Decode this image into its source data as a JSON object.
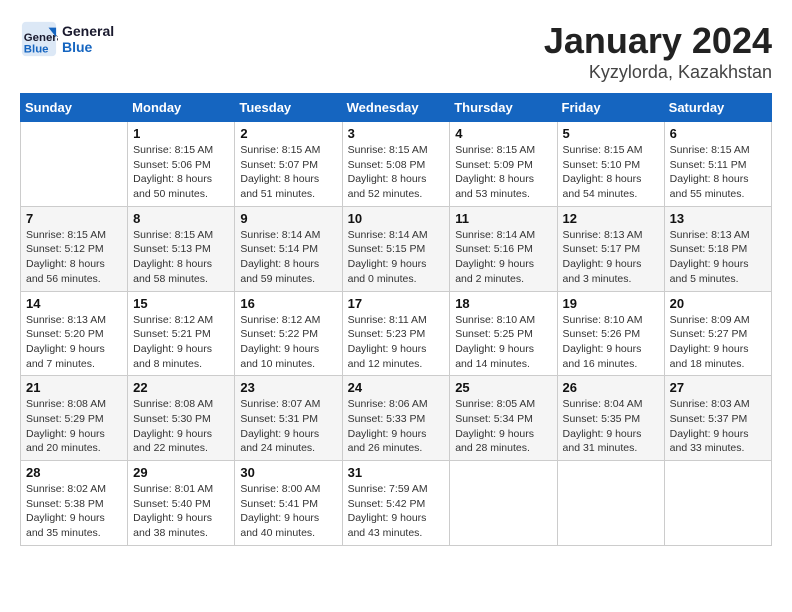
{
  "header": {
    "logo_line1": "General",
    "logo_line2": "Blue",
    "month": "January 2024",
    "location": "Kyzylorda, Kazakhstan"
  },
  "weekdays": [
    "Sunday",
    "Monday",
    "Tuesday",
    "Wednesday",
    "Thursday",
    "Friday",
    "Saturday"
  ],
  "weeks": [
    [
      {
        "day": "",
        "info": ""
      },
      {
        "day": "1",
        "info": "Sunrise: 8:15 AM\nSunset: 5:06 PM\nDaylight: 8 hours\nand 50 minutes."
      },
      {
        "day": "2",
        "info": "Sunrise: 8:15 AM\nSunset: 5:07 PM\nDaylight: 8 hours\nand 51 minutes."
      },
      {
        "day": "3",
        "info": "Sunrise: 8:15 AM\nSunset: 5:08 PM\nDaylight: 8 hours\nand 52 minutes."
      },
      {
        "day": "4",
        "info": "Sunrise: 8:15 AM\nSunset: 5:09 PM\nDaylight: 8 hours\nand 53 minutes."
      },
      {
        "day": "5",
        "info": "Sunrise: 8:15 AM\nSunset: 5:10 PM\nDaylight: 8 hours\nand 54 minutes."
      },
      {
        "day": "6",
        "info": "Sunrise: 8:15 AM\nSunset: 5:11 PM\nDaylight: 8 hours\nand 55 minutes."
      }
    ],
    [
      {
        "day": "7",
        "info": "Sunrise: 8:15 AM\nSunset: 5:12 PM\nDaylight: 8 hours\nand 56 minutes."
      },
      {
        "day": "8",
        "info": "Sunrise: 8:15 AM\nSunset: 5:13 PM\nDaylight: 8 hours\nand 58 minutes."
      },
      {
        "day": "9",
        "info": "Sunrise: 8:14 AM\nSunset: 5:14 PM\nDaylight: 8 hours\nand 59 minutes."
      },
      {
        "day": "10",
        "info": "Sunrise: 8:14 AM\nSunset: 5:15 PM\nDaylight: 9 hours\nand 0 minutes."
      },
      {
        "day": "11",
        "info": "Sunrise: 8:14 AM\nSunset: 5:16 PM\nDaylight: 9 hours\nand 2 minutes."
      },
      {
        "day": "12",
        "info": "Sunrise: 8:13 AM\nSunset: 5:17 PM\nDaylight: 9 hours\nand 3 minutes."
      },
      {
        "day": "13",
        "info": "Sunrise: 8:13 AM\nSunset: 5:18 PM\nDaylight: 9 hours\nand 5 minutes."
      }
    ],
    [
      {
        "day": "14",
        "info": "Sunrise: 8:13 AM\nSunset: 5:20 PM\nDaylight: 9 hours\nand 7 minutes."
      },
      {
        "day": "15",
        "info": "Sunrise: 8:12 AM\nSunset: 5:21 PM\nDaylight: 9 hours\nand 8 minutes."
      },
      {
        "day": "16",
        "info": "Sunrise: 8:12 AM\nSunset: 5:22 PM\nDaylight: 9 hours\nand 10 minutes."
      },
      {
        "day": "17",
        "info": "Sunrise: 8:11 AM\nSunset: 5:23 PM\nDaylight: 9 hours\nand 12 minutes."
      },
      {
        "day": "18",
        "info": "Sunrise: 8:10 AM\nSunset: 5:25 PM\nDaylight: 9 hours\nand 14 minutes."
      },
      {
        "day": "19",
        "info": "Sunrise: 8:10 AM\nSunset: 5:26 PM\nDaylight: 9 hours\nand 16 minutes."
      },
      {
        "day": "20",
        "info": "Sunrise: 8:09 AM\nSunset: 5:27 PM\nDaylight: 9 hours\nand 18 minutes."
      }
    ],
    [
      {
        "day": "21",
        "info": "Sunrise: 8:08 AM\nSunset: 5:29 PM\nDaylight: 9 hours\nand 20 minutes."
      },
      {
        "day": "22",
        "info": "Sunrise: 8:08 AM\nSunset: 5:30 PM\nDaylight: 9 hours\nand 22 minutes."
      },
      {
        "day": "23",
        "info": "Sunrise: 8:07 AM\nSunset: 5:31 PM\nDaylight: 9 hours\nand 24 minutes."
      },
      {
        "day": "24",
        "info": "Sunrise: 8:06 AM\nSunset: 5:33 PM\nDaylight: 9 hours\nand 26 minutes."
      },
      {
        "day": "25",
        "info": "Sunrise: 8:05 AM\nSunset: 5:34 PM\nDaylight: 9 hours\nand 28 minutes."
      },
      {
        "day": "26",
        "info": "Sunrise: 8:04 AM\nSunset: 5:35 PM\nDaylight: 9 hours\nand 31 minutes."
      },
      {
        "day": "27",
        "info": "Sunrise: 8:03 AM\nSunset: 5:37 PM\nDaylight: 9 hours\nand 33 minutes."
      }
    ],
    [
      {
        "day": "28",
        "info": "Sunrise: 8:02 AM\nSunset: 5:38 PM\nDaylight: 9 hours\nand 35 minutes."
      },
      {
        "day": "29",
        "info": "Sunrise: 8:01 AM\nSunset: 5:40 PM\nDaylight: 9 hours\nand 38 minutes."
      },
      {
        "day": "30",
        "info": "Sunrise: 8:00 AM\nSunset: 5:41 PM\nDaylight: 9 hours\nand 40 minutes."
      },
      {
        "day": "31",
        "info": "Sunrise: 7:59 AM\nSunset: 5:42 PM\nDaylight: 9 hours\nand 43 minutes."
      },
      {
        "day": "",
        "info": ""
      },
      {
        "day": "",
        "info": ""
      },
      {
        "day": "",
        "info": ""
      }
    ]
  ]
}
